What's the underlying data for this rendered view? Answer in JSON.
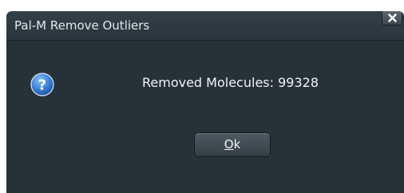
{
  "window": {
    "title": "Pal-M Remove Outliers"
  },
  "message": {
    "icon": "help-question-icon",
    "text": "Removed Molecules: 99328"
  },
  "buttons": {
    "ok_mnemonic": "O",
    "ok_rest": "k"
  },
  "colors": {
    "dialog_background": "#273138",
    "title_bar": "#2f3b43",
    "icon_blue": "#3f86df",
    "text": "#f2f4f5"
  }
}
